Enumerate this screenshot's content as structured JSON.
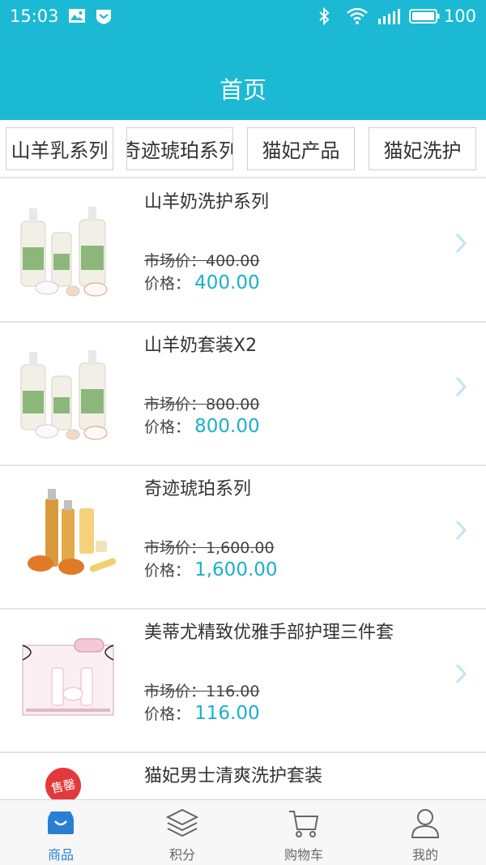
{
  "status_bar": {
    "time": "15:03",
    "battery": "100"
  },
  "header": {
    "title": "首页"
  },
  "categories": [
    {
      "label": "山羊乳系列"
    },
    {
      "label": "奇迹琥珀系列"
    },
    {
      "label": "猫妃产品"
    },
    {
      "label": "猫妃洗护"
    }
  ],
  "products": [
    {
      "name": "山羊奶洗护系列",
      "market_price": "市场价：400.00",
      "price_label": "价格：",
      "price": "400.00"
    },
    {
      "name": "山羊奶套装X2",
      "market_price": "市场价：800.00",
      "price_label": "价格：",
      "price": "800.00"
    },
    {
      "name": "奇迹琥珀系列",
      "market_price": "市场价：1,600.00",
      "price_label": "价格：",
      "price": "1,600.00"
    },
    {
      "name": "美蒂尤精致优雅手部护理三件套",
      "market_price": "市场价：116.00",
      "price_label": "价格：",
      "price": "116.00"
    },
    {
      "name": "猫妃男士清爽洗护套装",
      "badge": "售罄"
    }
  ],
  "tabbar": {
    "items": [
      {
        "label": "商品",
        "icon": "shop-icon",
        "active": true
      },
      {
        "label": "积分",
        "icon": "layers-icon",
        "active": false
      },
      {
        "label": "购物车",
        "icon": "cart-icon",
        "active": false
      },
      {
        "label": "我的",
        "icon": "user-icon",
        "active": false
      }
    ]
  },
  "colors": {
    "brand": "#1bb9d4",
    "price": "#1bb0c9",
    "active_tab": "#2a7fd4",
    "badge": "#e23a3a"
  }
}
